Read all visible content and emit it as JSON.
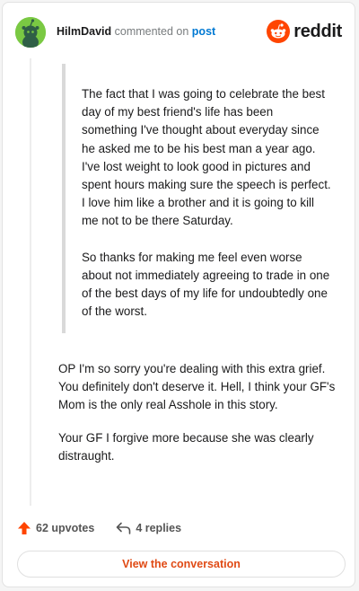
{
  "header": {
    "username": "HilmDavid",
    "action_text": "commented on",
    "link_text": "post",
    "logo_text": "reddit"
  },
  "quote": {
    "paragraphs": [
      "The fact that I was going to celebrate the best day of my best friend's life has been something I've thought about everyday since he asked me to be his best man a year ago. I've lost weight to look good in pictures and spent hours making sure the speech is perfect. I love him like a brother and it is going to kill me not to be there Saturday.",
      "So thanks for making me feel even worse about not immediately agreeing to trade in one of the best days of my life for undoubtedly one of the worst."
    ]
  },
  "comment": {
    "paragraphs": [
      "OP I'm so sorry you're dealing with this extra grief. You definitely don't deserve it. Hell, I think your GF's Mom is the only real Asshole in this story.",
      "Your GF I forgive more because she was clearly distraught."
    ]
  },
  "actions": {
    "upvotes": "62 upvotes",
    "replies": "4 replies"
  },
  "cta": {
    "label": "View the conversation"
  },
  "colors": {
    "brand": "#ff4500",
    "link": "#0079d3",
    "avatar": "#7ac943",
    "cta_text": "#e04a14"
  },
  "icons": {
    "avatar": "snoo-avatar-icon",
    "logo": "reddit-logo-icon",
    "upvote": "upvote-arrow-icon",
    "reply": "reply-arrow-icon"
  }
}
